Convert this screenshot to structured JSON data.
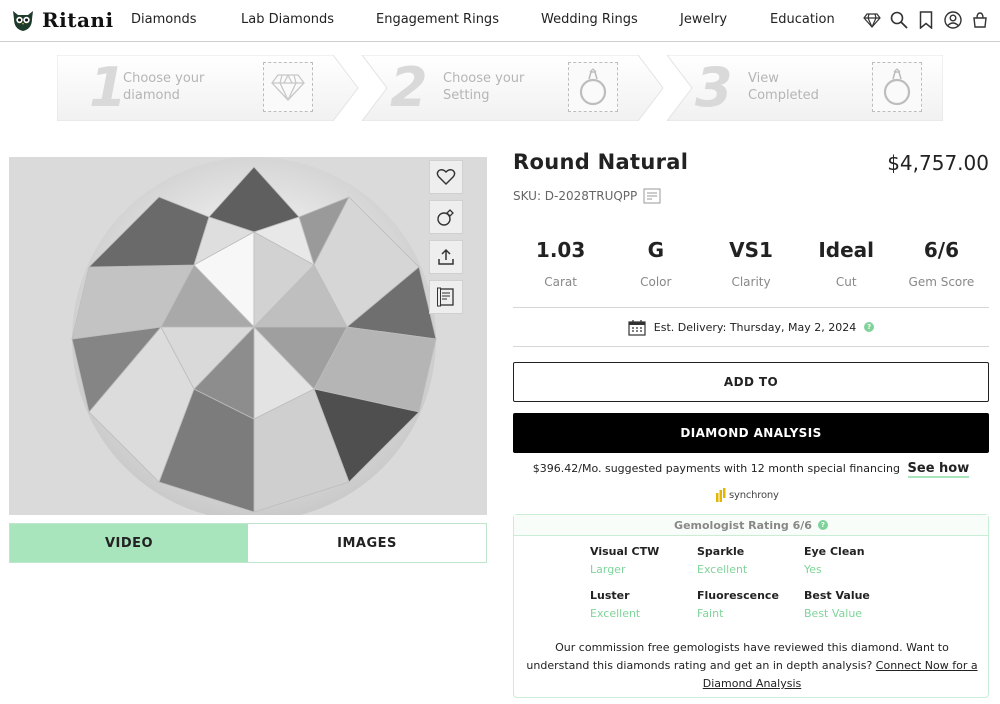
{
  "brand": {
    "name": "Ritani"
  },
  "nav": {
    "links": [
      "Diamonds",
      "Lab Diamonds",
      "Engagement Rings",
      "Wedding Rings",
      "Jewelry",
      "Education"
    ],
    "icons": [
      "diamond-icon",
      "search-icon",
      "bookmark-icon",
      "account-icon",
      "cart-icon"
    ]
  },
  "steps": [
    {
      "number": "1",
      "line1": "Choose your",
      "line2": "diamond",
      "icon": "diamond-outline-icon"
    },
    {
      "number": "2",
      "line1": "Choose your",
      "line2": "Setting",
      "icon": "ring-outline-icon"
    },
    {
      "number": "3",
      "line1": "View",
      "line2": "Completed",
      "icon": "ring-outline-icon"
    }
  ],
  "media": {
    "tools": [
      "heart-icon",
      "ring-link-icon",
      "share-icon",
      "certificate-icon"
    ],
    "tabs": {
      "video": "VIDEO",
      "images": "IMAGES",
      "active": "video"
    }
  },
  "product": {
    "title": "Round Natural",
    "price": "$4,757.00",
    "sku": "SKU: D-2028TRUQPP",
    "specs": [
      {
        "value": "1.03",
        "label": "Carat"
      },
      {
        "value": "G",
        "label": "Color"
      },
      {
        "value": "VS1",
        "label": "Clarity"
      },
      {
        "value": "Ideal",
        "label": "Cut"
      },
      {
        "value": "6/6",
        "label": "Gem Score"
      }
    ],
    "delivery": "Est. Delivery: Thursday, May 2, 2024",
    "add_to_label": "ADD TO",
    "analysis_label": "DIAMOND ANALYSIS",
    "financing_text": "$396.42/Mo. suggested payments with 12 month special financing",
    "see_how": "See how",
    "financing_brand": "synchrony"
  },
  "gem_rating": {
    "title": "Gemologist Rating 6/6",
    "attributes": [
      {
        "name": "Visual CTW",
        "value": "Larger"
      },
      {
        "name": "Sparkle",
        "value": "Excellent"
      },
      {
        "name": "Eye Clean",
        "value": "Yes"
      },
      {
        "name": "Luster",
        "value": "Excellent"
      },
      {
        "name": "Fluorescence",
        "value": "Faint"
      },
      {
        "name": "Best Value",
        "value": "Best Value"
      }
    ],
    "note": "Our commission free gemologists have reviewed this diamond. Want to understand this diamonds rating and get an in depth analysis?",
    "link": "Connect Now for a Diamond Analysis"
  },
  "colors": {
    "accent_green": "#a8e5bc",
    "value_green": "#7fd39a",
    "primary": "#000000"
  }
}
